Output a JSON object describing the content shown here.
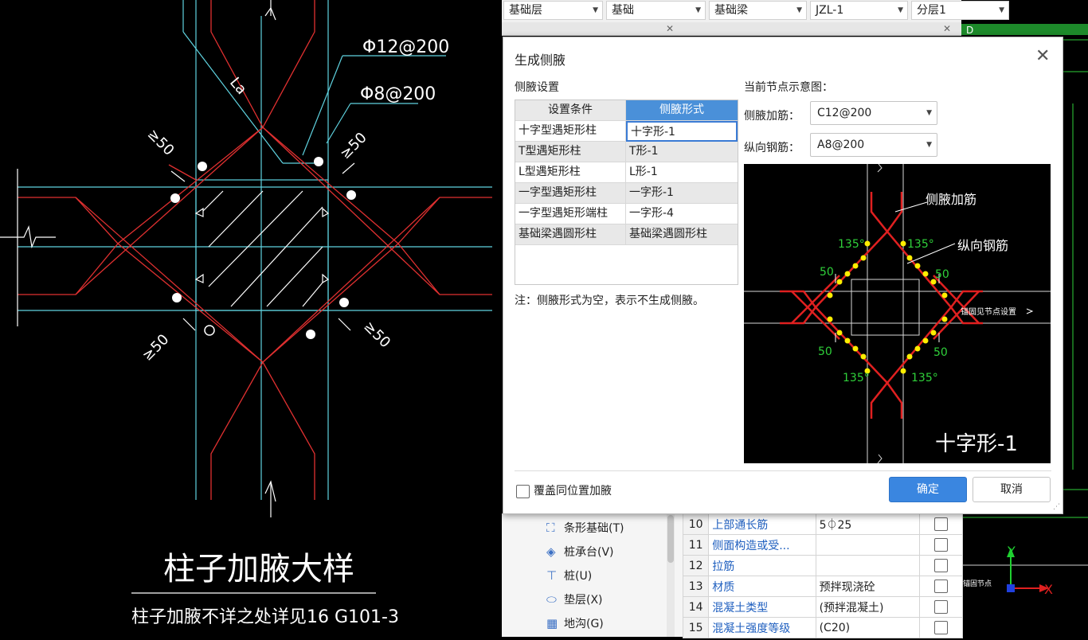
{
  "toolbar": {
    "combos": [
      {
        "value": "基础层"
      },
      {
        "value": "基础"
      },
      {
        "value": "基础梁"
      },
      {
        "value": "JZL-1"
      },
      {
        "value": "分层1"
      }
    ]
  },
  "cad_left": {
    "rebar_label_1": "Φ12@200",
    "rebar_label_2": "Φ8@200",
    "la_label": "La",
    "dim_50": "≥50",
    "title": "柱子加腋大样",
    "subtitle": "柱子加腋不详之处详见16 G101-3"
  },
  "dialog": {
    "title": "生成侧腋",
    "left_section_label": "侧腋设置",
    "grid": {
      "headers": [
        "设置条件",
        "侧腋形式"
      ],
      "rows": [
        [
          "十字型遇矩形柱",
          "十字形-1"
        ],
        [
          "T型遇矩形柱",
          "T形-1"
        ],
        [
          "L型遇矩形柱",
          "L形-1"
        ],
        [
          "一字型遇矩形柱",
          "一字形-1"
        ],
        [
          "一字型遇矩形端柱",
          "一字形-4"
        ],
        [
          "基础梁遇圆形柱",
          "基础梁遇圆形柱"
        ]
      ]
    },
    "note": "注：侧腋形式为空，表示不生成侧腋。",
    "right_section_label": "当前节点示意图：",
    "side_rebar_label": "侧腋加筋：",
    "side_rebar_value": "C12@200",
    "long_rebar_label": "纵向钢筋：",
    "long_rebar_value": "A8@200",
    "diagram": {
      "callout_side": "侧腋加筋",
      "callout_long": "纵向钢筋",
      "angle": "135°",
      "dim": "50",
      "anchor_note": "锚固见节点设置",
      "name": "十字形-1"
    },
    "checkbox_label": "覆盖同位置加腋",
    "ok_label": "确定",
    "cancel_label": "取消"
  },
  "tree": {
    "items": [
      {
        "icon": "strip-foundation-icon",
        "label": "条形基础(T)"
      },
      {
        "icon": "pile-cap-icon",
        "label": "桩承台(V)"
      },
      {
        "icon": "pile-icon",
        "label": "桩(U)"
      },
      {
        "icon": "cushion-icon",
        "label": "垫层(X)"
      },
      {
        "icon": "trench-icon",
        "label": "地沟(G)"
      }
    ]
  },
  "props": {
    "rows": [
      {
        "n": "10",
        "name": "上部通长筋",
        "value": "5⏀25"
      },
      {
        "n": "11",
        "name": "侧面构造或受...",
        "value": ""
      },
      {
        "n": "12",
        "name": "拉筋",
        "value": ""
      },
      {
        "n": "13",
        "name": "材质",
        "value": "预拌现浇砼"
      },
      {
        "n": "14",
        "name": "混凝土类型",
        "value": "(预拌混凝土)"
      },
      {
        "n": "15",
        "name": "混凝土强度等级",
        "value": "(C20)"
      }
    ]
  },
  "cad_right": {
    "axis_y": "Y",
    "axis_x": "X",
    "frag_text": "锚固节点"
  }
}
